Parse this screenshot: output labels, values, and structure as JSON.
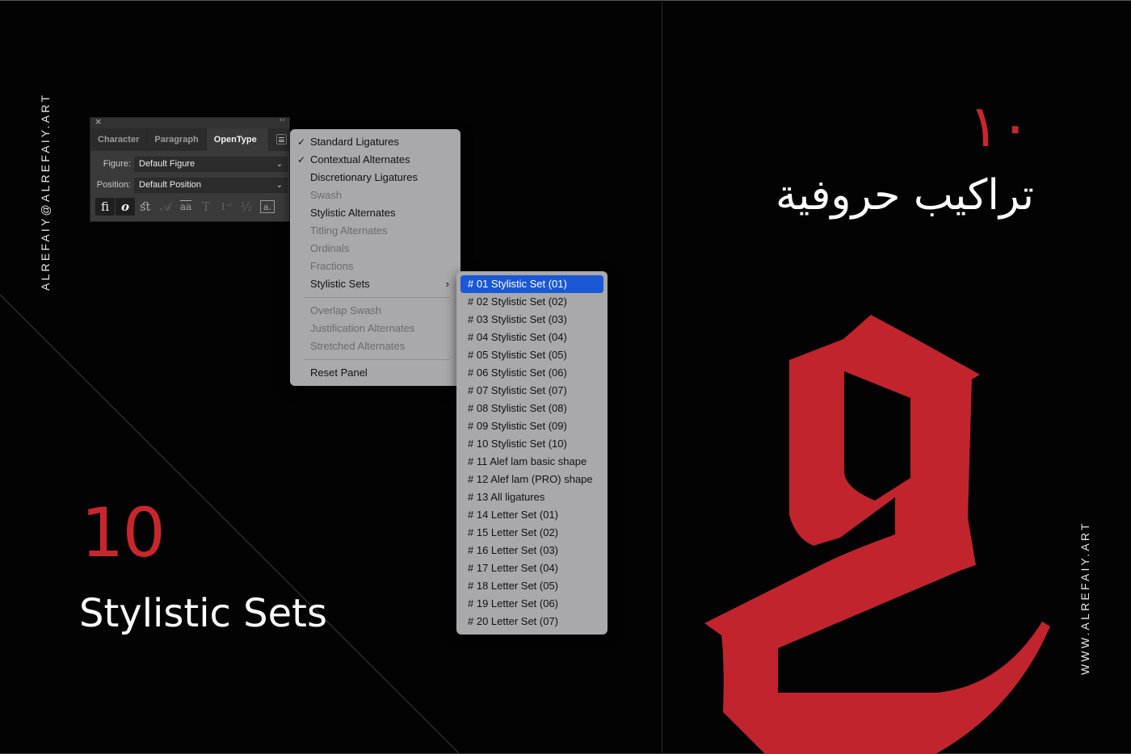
{
  "left": {
    "vertical_text": "ALREFAIY@ALREFAIY.ART",
    "big_number": "10",
    "title": "Stylistic Sets"
  },
  "right": {
    "arabic_number": "١٠",
    "arabic_title": "تراكيب حروفية",
    "vertical_text": "WWW.ALREFAIY.ART",
    "glyph_icon": "blackletter-g-glyph"
  },
  "colors": {
    "accent": "#c8262d",
    "background": "#030303",
    "menu_bg": "#a9a9ab",
    "selection": "#1a58d6"
  },
  "panel": {
    "close": "×",
    "collapse": "‹‹",
    "tabs": [
      {
        "label": "Character",
        "active": false
      },
      {
        "label": "Paragraph",
        "active": false
      },
      {
        "label": "OpenType",
        "active": true
      }
    ],
    "figure_label": "Figure:",
    "figure_value": "Default Figure",
    "position_label": "Position:",
    "position_value": "Default Position",
    "icons": [
      {
        "name": "standard-ligatures",
        "glyph": "ﬁ",
        "state": "on"
      },
      {
        "name": "contextual-alternates",
        "glyph": "𝒐",
        "state": "on"
      },
      {
        "name": "discretionary-ligatures",
        "glyph": "ﬆ",
        "state": "enabled"
      },
      {
        "name": "swash",
        "glyph": "𝒜",
        "state": "disabled"
      },
      {
        "name": "stylistic-alternates",
        "glyph": "aa",
        "state": "enabled"
      },
      {
        "name": "titling-alternates",
        "glyph": "T",
        "state": "disabled"
      },
      {
        "name": "ordinals",
        "glyph": "1ˢᵗ",
        "state": "disabled"
      },
      {
        "name": "fractions",
        "glyph": "½",
        "state": "disabled"
      },
      {
        "name": "stylistic-sets",
        "glyph": "a.",
        "state": "enabled"
      }
    ]
  },
  "menu": {
    "items": [
      {
        "label": "Standard Ligatures",
        "checked": true,
        "disabled": false
      },
      {
        "label": "Contextual Alternates",
        "checked": true,
        "disabled": false
      },
      {
        "label": "Discretionary Ligatures",
        "checked": false,
        "disabled": false
      },
      {
        "label": "Swash",
        "checked": false,
        "disabled": true
      },
      {
        "label": "Stylistic Alternates",
        "checked": false,
        "disabled": false
      },
      {
        "label": "Titling Alternates",
        "checked": false,
        "disabled": true
      },
      {
        "label": "Ordinals",
        "checked": false,
        "disabled": true
      },
      {
        "label": "Fractions",
        "checked": false,
        "disabled": true
      },
      {
        "label": "Stylistic Sets",
        "checked": false,
        "disabled": false,
        "submenu": true
      },
      {
        "label": "Overlap Swash",
        "checked": false,
        "disabled": true
      },
      {
        "label": "Justification Alternates",
        "checked": false,
        "disabled": true
      },
      {
        "label": "Stretched Alternates",
        "checked": false,
        "disabled": true
      },
      {
        "label": "Reset Panel",
        "checked": false,
        "disabled": false
      }
    ],
    "check_glyph": "✓",
    "submenu_arrow": "›"
  },
  "submenu": {
    "items": [
      {
        "label": "# 01 Stylistic Set (01)",
        "selected": true
      },
      {
        "label": "# 02 Stylistic Set (02)"
      },
      {
        "label": "# 03 Stylistic Set (03)"
      },
      {
        "label": "# 04 Stylistic Set (04)"
      },
      {
        "label": "# 05 Stylistic Set (05)"
      },
      {
        "label": "# 06 Stylistic Set (06)"
      },
      {
        "label": "# 07 Stylistic Set (07)"
      },
      {
        "label": "# 08 Stylistic Set (08)"
      },
      {
        "label": "# 09 Stylistic Set (09)"
      },
      {
        "label": "# 10 Stylistic Set (10)"
      },
      {
        "label": "# 11 Alef lam basic shape"
      },
      {
        "label": "# 12 Alef lam (PRO) shape"
      },
      {
        "label": "# 13 All ligatures"
      },
      {
        "label": "# 14 Letter Set (01)"
      },
      {
        "label": "# 15 Letter Set (02)"
      },
      {
        "label": "# 16 Letter Set (03)"
      },
      {
        "label": "# 17 Letter Set (04)"
      },
      {
        "label": "# 18 Letter Set (05)"
      },
      {
        "label": "# 19 Letter Set (06)"
      },
      {
        "label": "# 20 Letter Set (07)"
      }
    ]
  }
}
